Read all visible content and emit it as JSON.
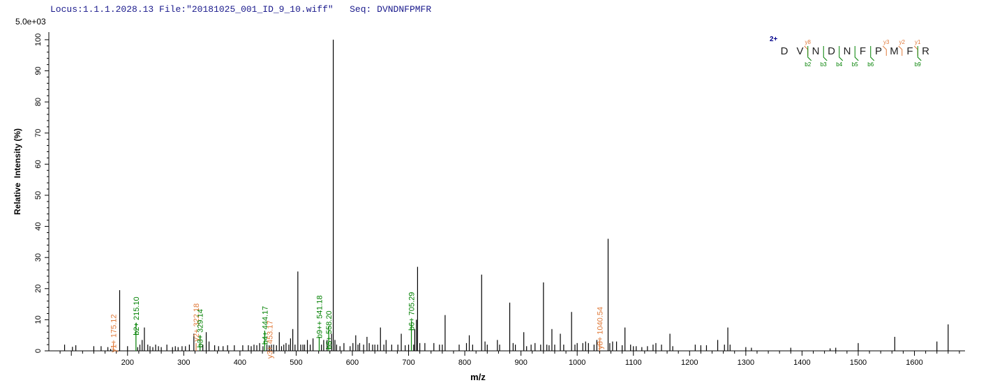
{
  "header": {
    "locus_label": "Locus:",
    "locus_value": "1.1.1.2028.13",
    "file_label": "File:",
    "file_value": "\"20181025_001_ID_9_10.wiff\"",
    "seq_label": "Seq:",
    "seq_value": "DVNDNFPMFR"
  },
  "colors": {
    "axis": "#000000",
    "peak": "#000000",
    "b_ion": "#008000",
    "y_ion": "#e07a3a",
    "charge": "#00008b",
    "header_text": "#1a1a8c"
  },
  "chart_data": {
    "type": "bar",
    "scale_label": "5.0e+03",
    "xlabel": "m/z",
    "ylabel": "Relative  Intensity (%)",
    "xlim": [
      60,
      1690
    ],
    "ylim": [
      0,
      102
    ],
    "x_ticks": [
      200,
      300,
      400,
      500,
      600,
      700,
      800,
      900,
      1000,
      1100,
      1200,
      1300,
      1400,
      1500,
      1600
    ],
    "x_minor_step": 20,
    "y_ticks": [
      0,
      10,
      20,
      30,
      40,
      50,
      60,
      70,
      80,
      90,
      100
    ],
    "y_minor_step": 2,
    "peaks": [
      [
        88,
        2
      ],
      [
        102,
        1.3
      ],
      [
        108,
        1.8
      ],
      [
        140,
        1.5
      ],
      [
        153,
        1.5
      ],
      [
        165,
        1.2
      ],
      [
        170,
        0.6
      ],
      [
        175,
        2.5
      ],
      [
        186,
        19.5
      ],
      [
        200,
        1.5
      ],
      [
        215,
        9
      ],
      [
        218,
        1.2
      ],
      [
        222,
        2
      ],
      [
        226,
        3.5
      ],
      [
        230,
        7.5
      ],
      [
        236,
        2
      ],
      [
        240,
        1.5
      ],
      [
        245,
        1.2
      ],
      [
        250,
        2
      ],
      [
        255,
        1.5
      ],
      [
        260,
        1.2
      ],
      [
        270,
        2
      ],
      [
        280,
        1.2
      ],
      [
        285,
        1.5
      ],
      [
        290,
        1.2
      ],
      [
        297,
        1.5
      ],
      [
        303,
        1.5
      ],
      [
        310,
        2
      ],
      [
        318,
        5.5
      ],
      [
        322,
        2.5
      ],
      [
        329,
        5
      ],
      [
        334,
        2
      ],
      [
        340,
        6
      ],
      [
        345,
        3
      ],
      [
        355,
        1.8
      ],
      [
        362,
        1.5
      ],
      [
        370,
        1.5
      ],
      [
        378,
        1.8
      ],
      [
        390,
        1.8
      ],
      [
        405,
        1.8
      ],
      [
        415,
        1.8
      ],
      [
        420,
        1.5
      ],
      [
        425,
        2
      ],
      [
        430,
        1.8
      ],
      [
        435,
        2.5
      ],
      [
        441,
        1.5
      ],
      [
        444,
        6.5
      ],
      [
        448,
        2
      ],
      [
        452,
        1.8
      ],
      [
        456,
        2
      ],
      [
        460,
        2
      ],
      [
        465,
        1.8
      ],
      [
        470,
        6
      ],
      [
        474,
        1.5
      ],
      [
        478,
        2
      ],
      [
        482,
        2.5
      ],
      [
        487,
        2
      ],
      [
        490,
        4
      ],
      [
        494,
        7
      ],
      [
        498,
        2
      ],
      [
        503,
        25.5
      ],
      [
        508,
        2
      ],
      [
        512,
        2
      ],
      [
        515,
        2
      ],
      [
        520,
        3.5
      ],
      [
        525,
        2
      ],
      [
        530,
        4
      ],
      [
        541,
        4.5
      ],
      [
        545,
        2
      ],
      [
        549,
        3.5
      ],
      [
        555,
        3.5
      ],
      [
        558,
        8
      ],
      [
        563,
        5.5
      ],
      [
        566,
        100
      ],
      [
        569,
        3.5
      ],
      [
        572,
        2
      ],
      [
        578,
        1.5
      ],
      [
        585,
        2.5
      ],
      [
        596,
        1.5
      ],
      [
        601,
        2.5
      ],
      [
        606,
        5
      ],
      [
        610,
        2
      ],
      [
        613,
        2.5
      ],
      [
        620,
        2
      ],
      [
        626,
        4.5
      ],
      [
        630,
        2.5
      ],
      [
        636,
        2
      ],
      [
        640,
        2
      ],
      [
        645,
        2
      ],
      [
        650,
        7.5
      ],
      [
        656,
        2
      ],
      [
        660,
        3.5
      ],
      [
        670,
        2
      ],
      [
        681,
        2
      ],
      [
        687,
        5.5
      ],
      [
        694,
        1.8
      ],
      [
        700,
        2
      ],
      [
        705,
        9.5
      ],
      [
        709,
        2
      ],
      [
        711,
        7
      ],
      [
        714,
        10
      ],
      [
        716,
        27
      ],
      [
        720,
        2.5
      ],
      [
        729,
        2.5
      ],
      [
        745,
        2.5
      ],
      [
        755,
        2
      ],
      [
        760,
        2
      ],
      [
        765,
        11.5
      ],
      [
        790,
        2
      ],
      [
        803,
        2.5
      ],
      [
        808,
        5
      ],
      [
        814,
        2
      ],
      [
        830,
        24.5
      ],
      [
        836,
        3
      ],
      [
        840,
        2
      ],
      [
        858,
        3.5
      ],
      [
        862,
        2
      ],
      [
        880,
        15.5
      ],
      [
        886,
        2.5
      ],
      [
        890,
        2
      ],
      [
        905,
        6
      ],
      [
        910,
        1.5
      ],
      [
        918,
        2
      ],
      [
        925,
        2.5
      ],
      [
        935,
        2
      ],
      [
        940,
        22
      ],
      [
        946,
        2
      ],
      [
        950,
        1.8
      ],
      [
        955,
        7
      ],
      [
        960,
        2
      ],
      [
        970,
        5.5
      ],
      [
        976,
        2
      ],
      [
        990,
        12.5
      ],
      [
        996,
        2
      ],
      [
        1000,
        2.5
      ],
      [
        1010,
        2.5
      ],
      [
        1015,
        3
      ],
      [
        1020,
        2.5
      ],
      [
        1030,
        2
      ],
      [
        1035,
        3.5
      ],
      [
        1040,
        3.5
      ],
      [
        1055,
        36
      ],
      [
        1058,
        2.5
      ],
      [
        1063,
        3
      ],
      [
        1070,
        3
      ],
      [
        1080,
        1.8
      ],
      [
        1085,
        7.5
      ],
      [
        1095,
        2
      ],
      [
        1100,
        1.5
      ],
      [
        1105,
        1.5
      ],
      [
        1115,
        1.2
      ],
      [
        1125,
        1.5
      ],
      [
        1135,
        2
      ],
      [
        1140,
        2.5
      ],
      [
        1150,
        2
      ],
      [
        1165,
        5.5
      ],
      [
        1170,
        1.5
      ],
      [
        1210,
        2
      ],
      [
        1220,
        1.8
      ],
      [
        1230,
        1.8
      ],
      [
        1250,
        3.5
      ],
      [
        1262,
        2
      ],
      [
        1268,
        7.5
      ],
      [
        1272,
        2
      ],
      [
        1300,
        1.2
      ],
      [
        1310,
        1
      ],
      [
        1380,
        1
      ],
      [
        1450,
        0.8
      ],
      [
        1460,
        1
      ],
      [
        1500,
        2.5
      ],
      [
        1565,
        4.5
      ],
      [
        1640,
        3
      ],
      [
        1660,
        8.5
      ]
    ],
    "annotations": [
      {
        "label": "y1+ 175.12",
        "mz": 175,
        "ion": "y",
        "top": 16
      },
      {
        "label": "b2+ 215.10",
        "mz": 215,
        "ion": "b",
        "top": 21.5
      },
      {
        "label": "y2+ 322.18",
        "mz": 322,
        "ion": "y",
        "top": 19.5
      },
      {
        "label": "b3+ 329.14",
        "mz": 329,
        "ion": "b",
        "top": 17.5
      },
      {
        "label": "b4+ 444.17",
        "mz": 444,
        "ion": "b",
        "top": 18.5
      },
      {
        "label": "y3+ 453.17",
        "mz": 453,
        "ion": "y",
        "top": 14
      },
      {
        "label": "b9++ 541.18",
        "mz": 541,
        "ion": "b",
        "top": 20.5
      },
      {
        "label": "b5+ 558.20",
        "mz": 558,
        "ion": "b",
        "top": 17
      },
      {
        "label": "b6+ 705.29",
        "mz": 705,
        "ion": "b",
        "top": 23
      },
      {
        "label": "y8+ 1040.54",
        "mz": 1040,
        "ion": "y",
        "top": 17
      }
    ]
  },
  "sequence_map": {
    "charge": "2+",
    "residues": [
      "D",
      "V",
      "N",
      "D",
      "N",
      "F",
      "P",
      "M",
      "F",
      "R"
    ],
    "y_marks": [
      {
        "after": 2,
        "label": "y8"
      },
      {
        "after": 7,
        "label": "y3"
      },
      {
        "after": 8,
        "label": "y2"
      },
      {
        "after": 9,
        "label": "y1"
      }
    ],
    "b_marks": [
      {
        "after": 2,
        "label": "b2"
      },
      {
        "after": 3,
        "label": "b3"
      },
      {
        "after": 4,
        "label": "b4"
      },
      {
        "after": 5,
        "label": "b5"
      },
      {
        "after": 6,
        "label": "b6"
      },
      {
        "after": 9,
        "label": "b9"
      }
    ]
  }
}
